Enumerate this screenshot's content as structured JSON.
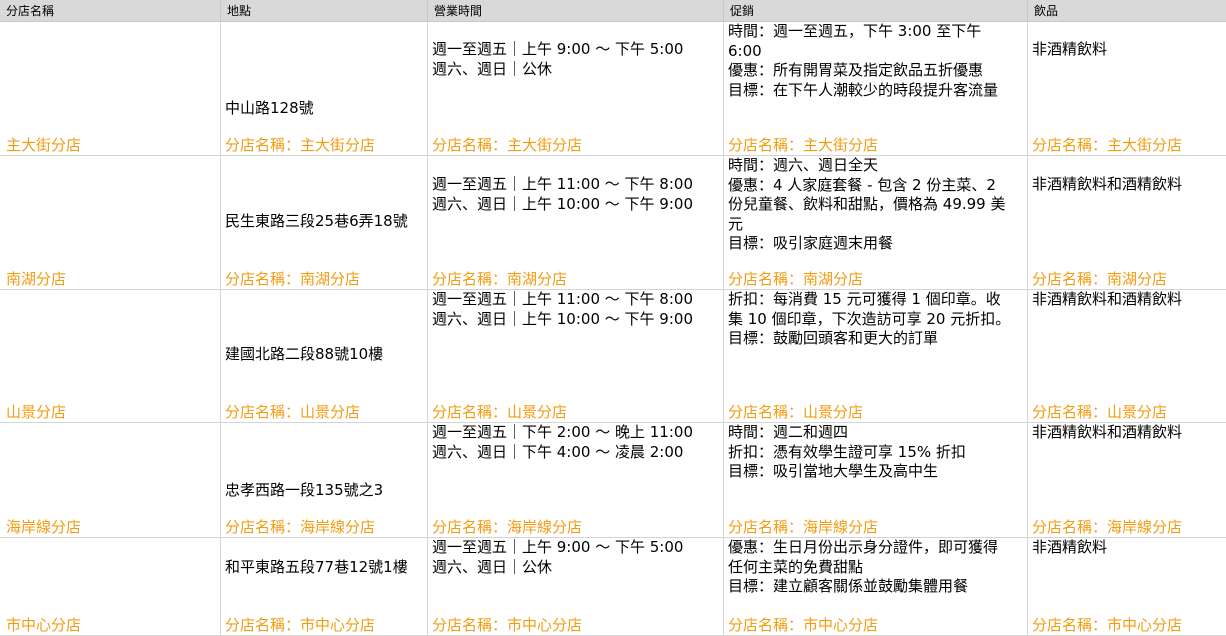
{
  "headers": [
    "分店名稱",
    "地點",
    "營業時間",
    "促銷",
    "飲品"
  ],
  "rows": [
    {
      "name": "主大街分店",
      "location": "中山路128號",
      "hours": "週一至週五｜上午 9:00 ～ 下午 5:00\n週六、週日｜公休",
      "promo": "時間：週一至週五，下午 3:00 至下午\n6:00\n優惠：所有開胃菜及指定飲品五折優惠\n目標：在下午人潮較少的時段提升客流量",
      "drinks": "非酒精飲料",
      "label": "分店名稱：主大街分店"
    },
    {
      "name": "南湖分店",
      "location": "民生東路三段25巷6弄18號",
      "hours": "週一至週五｜上午 11:00 ～ 下午 8:00\n週六、週日｜上午 10:00 ～ 下午 9:00",
      "promo": "時間：週六、週日全天\n優惠：4 人家庭套餐 - 包含 2 份主菜、2\n份兒童餐、飲料和甜點，價格為 49.99 美\n元\n目標：吸引家庭週末用餐",
      "drinks": "非酒精飲料和酒精飲料",
      "label": "分店名稱：南湖分店"
    },
    {
      "name": "山景分店",
      "location": "建國北路二段88號10樓",
      "hours": "週一至週五｜上午 11:00 ～ 下午 8:00\n週六、週日｜上午 10:00 ～ 下午 9:00",
      "promo": "折扣：每消費 15 元可獲得 1 個印章。收\n集 10 個印章，下次造訪可享 20 元折扣。\n目標：鼓勵回頭客和更大的訂單",
      "drinks": "非酒精飲料和酒精飲料",
      "label": "分店名稱：山景分店"
    },
    {
      "name": "海岸線分店",
      "location": "忠孝西路一段135號之3",
      "hours": "週一至週五｜下午 2:00 ～ 晚上 11:00\n週六、週日｜下午 4:00 ～ 凌晨 2:00",
      "promo": "時間：週二和週四\n折扣：憑有效學生證可享 15% 折扣\n目標：吸引當地大學生及高中生",
      "drinks": "非酒精飲料和酒精飲料",
      "label": "分店名稱：海岸線分店"
    },
    {
      "name": "市中心分店",
      "location": "和平東路五段77巷12號1樓",
      "hours": "週一至週五｜上午 9:00 ～ 下午 5:00\n週六、週日｜公休",
      "promo": "優惠：生日月份出示身分證件，即可獲得\n任何主菜的免費甜點\n目標：建立顧客關係並鼓勵集體用餐",
      "drinks": "非酒精飲料",
      "label": "分店名稱：市中心分店"
    }
  ]
}
